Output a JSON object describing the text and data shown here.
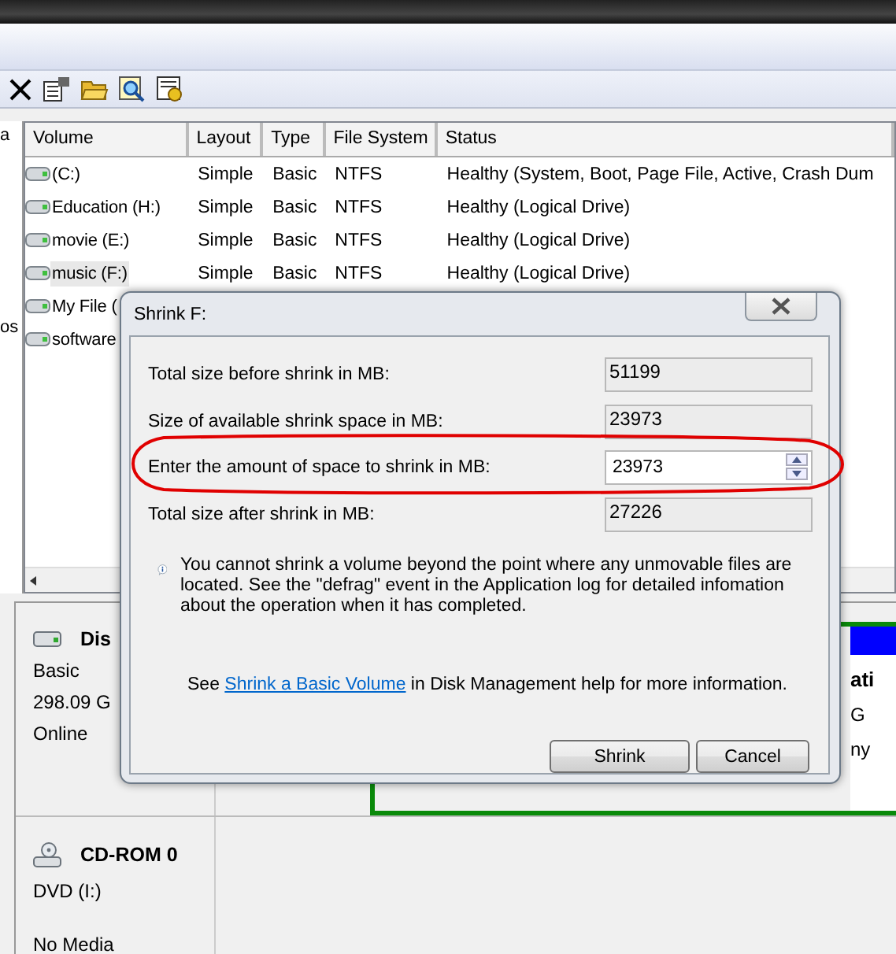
{
  "left_pane": {
    "items": [
      "a",
      "os"
    ]
  },
  "volume_table": {
    "columns": [
      "Volume",
      "Layout",
      "Type",
      "File System",
      "Status"
    ],
    "rows": [
      {
        "cells": [
          "(C:)",
          "Simple",
          "Basic",
          "NTFS",
          "Healthy (System, Boot, Page File, Active, Crash Dum"
        ],
        "selected": false
      },
      {
        "cells": [
          "Education (H:)",
          "Simple",
          "Basic",
          "NTFS",
          "Healthy (Logical Drive)"
        ],
        "selected": false
      },
      {
        "cells": [
          "movie (E:)",
          "Simple",
          "Basic",
          "NTFS",
          "Healthy (Logical Drive)"
        ],
        "selected": false
      },
      {
        "cells": [
          "music (F:)",
          "Simple",
          "Basic",
          "NTFS",
          "Healthy (Logical Drive)"
        ],
        "selected": true
      },
      {
        "cells": [
          "My File ("
        ],
        "selected": false
      },
      {
        "cells": [
          "software"
        ],
        "selected": false
      }
    ]
  },
  "disks": [
    {
      "kind": "disk",
      "name": "Dis",
      "lines": [
        "Basic",
        "298.09 G",
        "Online"
      ],
      "partition_texts": [
        "ati",
        "G",
        "ny"
      ]
    },
    {
      "kind": "cdrom",
      "name": "CD-ROM 0",
      "lines": [
        "DVD (I:)",
        "No Media"
      ]
    }
  ],
  "dialog": {
    "title": "Shrink F:",
    "fields": [
      {
        "kind": "readonly",
        "label": "Total size before shrink in MB:",
        "value": "51199"
      },
      {
        "kind": "readonly",
        "label": "Size of available shrink space in MB:",
        "value": "23973"
      },
      {
        "kind": "spin",
        "label": "Enter the amount of space to shrink in MB:",
        "value": "23973"
      },
      {
        "kind": "readonly",
        "label": "Total size after shrink in MB:",
        "value": "27226"
      }
    ],
    "info": "You cannot shrink a volume beyond the point where any unmovable files are located. See the \"defrag\" event in the Application log for detailed infomation about the operation when it has completed.",
    "help": {
      "before": "See ",
      "link": "Shrink a Basic Volume",
      "after": " in Disk Management help for more information."
    },
    "buttons": [
      "Shrink",
      "Cancel"
    ]
  }
}
